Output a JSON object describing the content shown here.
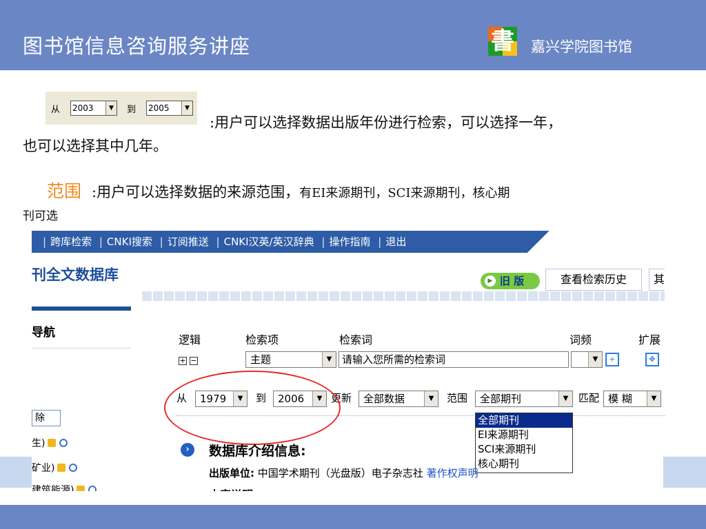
{
  "slide": {
    "title": "图书馆信息咨询服务讲座",
    "org": "嘉兴学院图书馆",
    "logo_char": "書",
    "text_years_1": ":用户可以选择数据出版年份进行检索，可以选择一年，",
    "text_years_2": "也可以选择其中几年。",
    "scope_label": "范围",
    "text_scope_1": ":用户可以选择数据的来源范围，",
    "text_scope_1b": "有EI来源期刊，SCI来源期刊，核心期",
    "text_scope_2": "刊可选",
    "mini_from": "从",
    "mini_from_year": "2003",
    "mini_to": "到",
    "mini_to_year": "2005",
    "colors": {
      "header": "#6a86c4",
      "scope_label": "#f08a1e",
      "ellipse": "#e52a2a"
    }
  },
  "screenshot": {
    "nav": [
      "跨库检索",
      "CNKI搜索",
      "订阅推送",
      "CNKI汉英/英汉辞典",
      "操作指南",
      "退出"
    ],
    "db_title": "刊全文数据库",
    "old_version": "旧 版",
    "history_tab": "查看检索历史",
    "more_tab": "其",
    "left_nav_label": "导航",
    "side_input": "除",
    "side_rows": [
      "生)",
      "矿业)",
      "建筑能源)"
    ],
    "columns": {
      "logic": "逻辑",
      "field": "检索项",
      "keyword": "检索词",
      "freq": "词频",
      "expand": "扩展"
    },
    "field_value": "主题",
    "keyword_placeholder": "请输入您所需的检索词",
    "from_label": "从",
    "from_year": "1979",
    "to_label": "到",
    "to_year": "2006",
    "update_label": "更新",
    "update_value": "全部数据",
    "scope_label": "范围",
    "scope_value": "全部期刊",
    "match_label": "匹配",
    "match_value": "模 糊",
    "scope_options": [
      "全部期刊",
      "EI来源期刊",
      "SCI来源期刊",
      "核心期刊"
    ],
    "intro_title": "数据库介绍信息:",
    "publisher_label": "出版单位:",
    "publisher_value": "中国学术期刊（光盘版）电子杂志社",
    "publisher_link": "著作权声明",
    "cut_text": "内容说明"
  }
}
